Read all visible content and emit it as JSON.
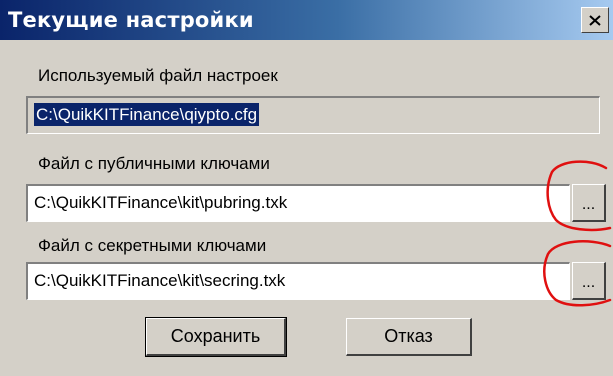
{
  "window": {
    "title": "Текущие настройки",
    "close_icon": "close-icon"
  },
  "settings_file": {
    "label": "Используемый файл настроек",
    "value": "C:\\QuikKITFinance\\qiypto.cfg"
  },
  "public_keys": {
    "label": "Файл с публичными ключами",
    "value": "C:\\QuikKITFinance\\kit\\pubring.txk",
    "browse_label": "..."
  },
  "secret_keys": {
    "label": "Файл с секретными ключами",
    "value": "C:\\QuikKITFinance\\kit\\secring.txk",
    "browse_label": "..."
  },
  "buttons": {
    "save": "Сохранить",
    "cancel": "Отказ"
  },
  "annotation_color": "#e01010"
}
